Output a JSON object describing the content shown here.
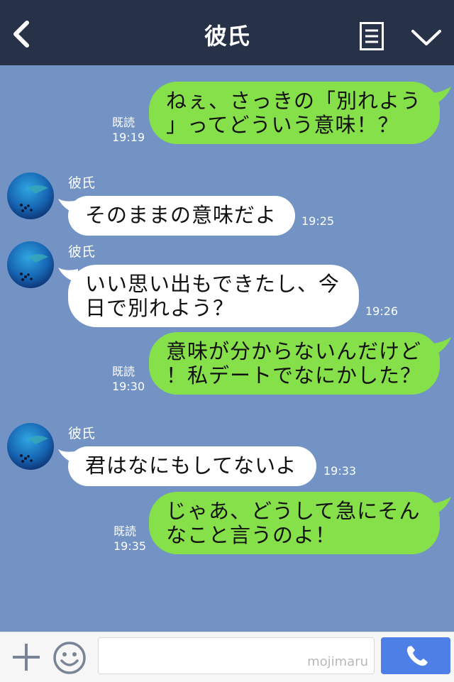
{
  "header": {
    "title": "彼氏",
    "back_icon": "chevron-left-icon",
    "menu_icon": "list-icon",
    "collapse_icon": "chevron-down-icon"
  },
  "messages": [
    {
      "from": "me",
      "text": "ねぇ、さっきの「別れよう\n」ってどういう意味！？",
      "read": "既読",
      "time": "19:19"
    },
    {
      "from": "them",
      "sender": "彼氏",
      "text": "そのままの意味だよ",
      "time": "19:25"
    },
    {
      "from": "them",
      "sender": "彼氏",
      "text": "いい思い出もできたし、今\n日で別れよう？",
      "time": "19:26"
    },
    {
      "from": "me",
      "text": "意味が分からないんだけど\n！私デートでなにかした？",
      "read": "既読",
      "time": "19:30"
    },
    {
      "from": "them",
      "sender": "彼氏",
      "text": "君はなにもしてないよ",
      "time": "19:33"
    },
    {
      "from": "me",
      "text": "じゃあ、どうして急にそん\nなこと言うのよ！",
      "read": "既読",
      "time": "19:35"
    }
  ],
  "footer": {
    "watermark": "mojimaru",
    "plus_icon": "plus-icon",
    "emoji_icon": "smiley-icon",
    "send_icon": "phone-icon"
  },
  "colors": {
    "header": "#273248",
    "background": "#7393c5",
    "my_bubble": "#86e04a",
    "their_bubble": "#ffffff",
    "send": "#4e7fe6"
  }
}
